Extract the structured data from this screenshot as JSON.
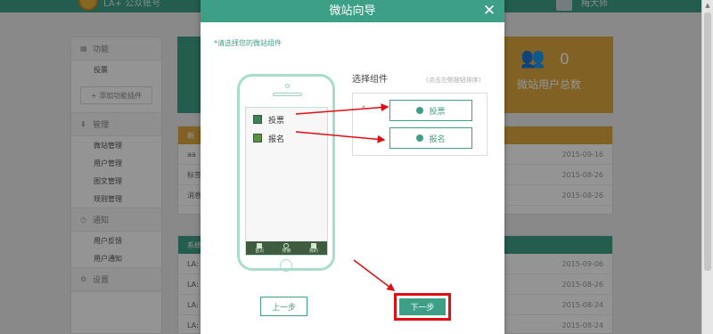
{
  "background": {
    "app_title": "LA+ 公众账号",
    "user_name": "梅大师",
    "sidebar": {
      "sections": [
        {
          "title": "功能",
          "icon": "grid-icon",
          "items": [
            "投票"
          ],
          "add_button": "+ 添加功能插件"
        },
        {
          "title": "管理",
          "icon": "download-icon",
          "items": [
            "微站管理",
            "用户管理",
            "图文管理",
            "规则管理"
          ]
        },
        {
          "title": "通知",
          "icon": "clock-icon",
          "items": [
            "用户反馈",
            "用户通知"
          ]
        },
        {
          "title": "设置",
          "icon": "gear-icon",
          "items": []
        }
      ]
    },
    "stat_users": {
      "value": "0",
      "label": "微站用户总数"
    },
    "news_panel": {
      "header": "新",
      "rows": [
        {
          "title": "aa",
          "date": "2015-09-16"
        },
        {
          "title": "标签",
          "date": "2015-08-26"
        },
        {
          "title": "消息",
          "date": "2015-08-26"
        }
      ]
    },
    "system_panel": {
      "header": "系统",
      "rows": [
        {
          "title": "LA:",
          "date": "2015-09-06"
        },
        {
          "title": "LA:",
          "date": "2015-08-26"
        },
        {
          "title": "LA:",
          "date": "2015-08-24"
        },
        {
          "title": "LA:",
          "date": "2015-08-24"
        }
      ]
    }
  },
  "modal": {
    "title": "微站向导",
    "hint": "*请选择您的微站组件",
    "phone": {
      "items": [
        "投票",
        "报名"
      ],
      "tabs": [
        "首页",
        "搜索",
        "我的"
      ]
    },
    "picker": {
      "title": "选择组件",
      "tip": "(点击左侧按钮排序)",
      "star": "*",
      "options": [
        "投票",
        "报名"
      ]
    },
    "prev_label": "上一步",
    "next_label": "下一步"
  },
  "colors": {
    "primary": "#3e9f87",
    "accent": "#e0aa3e",
    "highlight": "#e10d12"
  }
}
